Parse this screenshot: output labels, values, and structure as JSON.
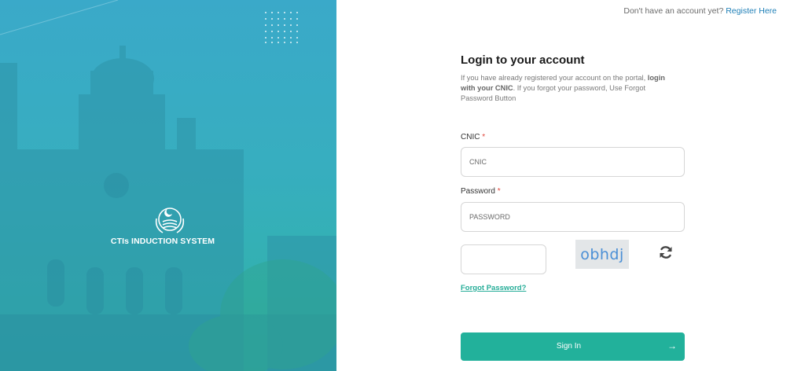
{
  "hero": {
    "system_title": "CTIs INDUCTION SYSTEM",
    "colors": {
      "top": "#3aa9c9",
      "bottom": "#2fb3a5"
    },
    "emblem_icon": "punjab-emblem-icon"
  },
  "header": {
    "question": "Don't have an account yet?",
    "register_link": "Register Here"
  },
  "login": {
    "title": "Login to your account",
    "desc_part1": "If you have already registered your account on the portal,",
    "desc_bold": "login with your CNIC",
    "desc_part2": ". If you forgot your password, Use Forgot Password Button",
    "cnic_label": "CNIC",
    "cnic_placeholder": "CNIC",
    "password_label": "Password",
    "password_placeholder": "PASSWORD",
    "required_mark": "*",
    "captcha_input_value": "",
    "captcha_text": "obhdj",
    "refresh_icon": "refresh-icon",
    "forgot_link": "Forgot Password?",
    "signin_label": "Sign In",
    "signin_arrow": "→",
    "accent_color": "#22b19b"
  }
}
